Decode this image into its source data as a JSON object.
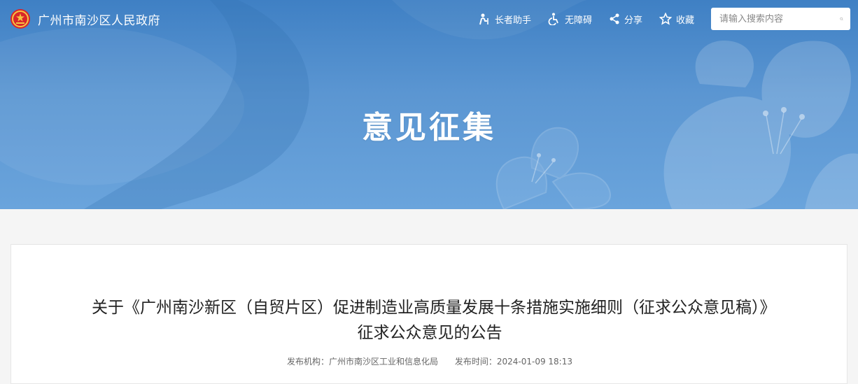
{
  "header": {
    "site_name": "广州市南沙区人民政府",
    "tools": [
      {
        "label": "长者助手",
        "icon": "elder-icon"
      },
      {
        "label": "无障碍",
        "icon": "accessibility-icon"
      },
      {
        "label": "分享",
        "icon": "share-icon"
      },
      {
        "label": "收藏",
        "icon": "star-icon"
      }
    ],
    "search": {
      "placeholder": "请输入搜索内容",
      "value": ""
    }
  },
  "banner": {
    "title": "意见征集"
  },
  "article": {
    "title": "关于《广州南沙新区（自贸片区）促进制造业高质量发展十条措施实施细则（征求公众意见稿）》征求公众意见的公告",
    "publisher_label": "发布机构：",
    "publisher": "广州市南沙区工业和信息化局",
    "time_label": "发布时间：",
    "time": "2024-01-09 18:13"
  },
  "colors": {
    "banner": "#4f8bcb",
    "text": "#222222",
    "meta": "#666666"
  }
}
